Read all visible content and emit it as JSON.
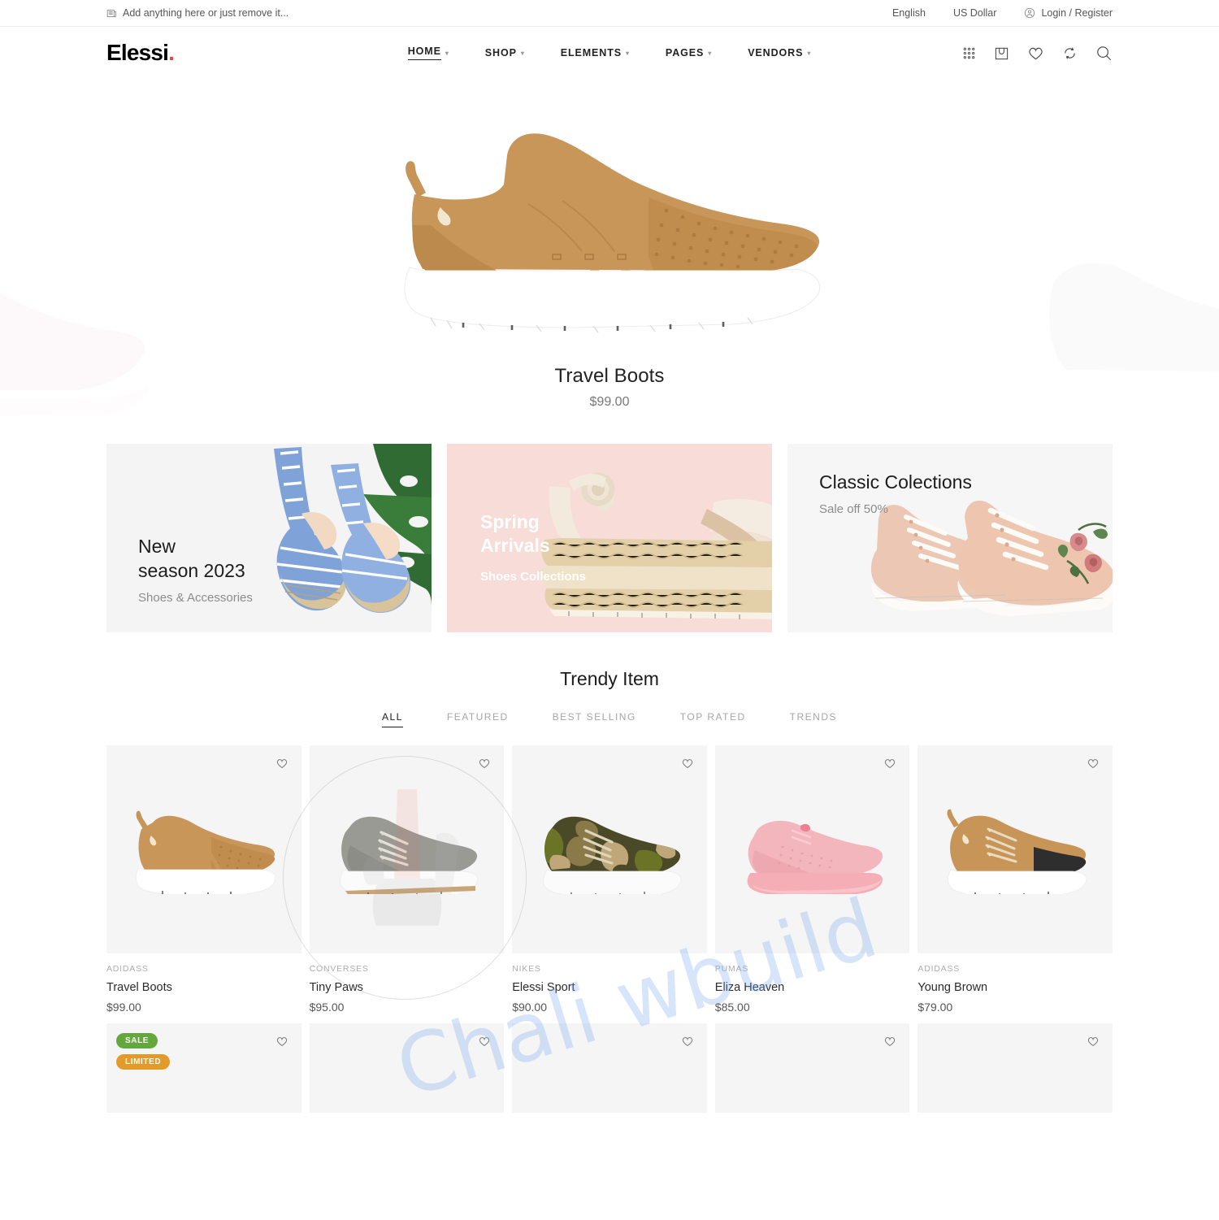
{
  "topbar": {
    "notice_icon": "newspaper-icon",
    "notice": "Add anything here or just remove it...",
    "language": "English",
    "currency": "US Dollar",
    "account_icon": "user-icon",
    "account": "Login / Register"
  },
  "header": {
    "logo": "Elessi",
    "logo_dot": ".",
    "nav": [
      {
        "label": "HOME",
        "has_caret": true,
        "active": true
      },
      {
        "label": "SHOP",
        "has_caret": true,
        "active": false
      },
      {
        "label": "ELEMENTS",
        "has_caret": true,
        "active": false
      },
      {
        "label": "PAGES",
        "has_caret": true,
        "active": false
      },
      {
        "label": "VENDORS",
        "has_caret": true,
        "active": false
      }
    ],
    "icons": [
      "grid-icon",
      "shopping-bag-icon",
      "heart-icon",
      "compare-icon",
      "search-icon"
    ]
  },
  "hero": {
    "title": "Travel Boots",
    "price": "$99.00",
    "colors": {
      "shoe": "#c79558",
      "sole": "#ffffff",
      "side_left": "#fbeef0",
      "side_right": "#f2f2f2"
    }
  },
  "banners": [
    {
      "id": "new-season",
      "heading_line1": "New",
      "heading_line2": "season 2023",
      "sub": "Shoes & Accessories",
      "bg": "#f4f4f4"
    },
    {
      "id": "spring-arrivals",
      "heading_line1": "Spring",
      "heading_line2": "Arrivals",
      "sub": "Shoes Collections",
      "bg": "#f7dcd8"
    },
    {
      "id": "classic-collections",
      "heading_line1": "Classic Colections",
      "heading_line2": "",
      "sub": "Sale off 50%",
      "bg": "#f6f6f6"
    }
  ],
  "trendy": {
    "title": "Trendy Item",
    "tabs": [
      {
        "label": "ALL",
        "active": true
      },
      {
        "label": "FEATURED",
        "active": false
      },
      {
        "label": "BEST SELLING",
        "active": false
      },
      {
        "label": "TOP RATED",
        "active": false
      },
      {
        "label": "TRENDS",
        "active": false
      }
    ],
    "products": [
      {
        "brand": "ADIDASS",
        "name": "Travel Boots",
        "price": "$99.00",
        "shoe": "tan",
        "badges": []
      },
      {
        "brand": "CONVERSES",
        "name": "Tiny Paws",
        "price": "$95.00",
        "shoe": "grey",
        "badges": []
      },
      {
        "brand": "NIKES",
        "name": "Elessi Sport",
        "price": "$90.00",
        "shoe": "camo",
        "badges": []
      },
      {
        "brand": "PUMAS",
        "name": "Eliza Heaven",
        "price": "$85.00",
        "shoe": "pink",
        "badges": []
      },
      {
        "brand": "ADIDASS",
        "name": "Young Brown",
        "price": "$79.00",
        "shoe": "tan2",
        "badges": []
      }
    ],
    "products_row2": [
      {
        "badges": [
          {
            "label": "SALE",
            "color": "#62a83c"
          },
          {
            "label": "LIMITED",
            "color": "#e39a28"
          }
        ]
      },
      {
        "badges": []
      },
      {
        "badges": []
      },
      {
        "badges": []
      },
      {
        "badges": []
      }
    ]
  },
  "watermark": {
    "text": "Chali wbuild"
  }
}
